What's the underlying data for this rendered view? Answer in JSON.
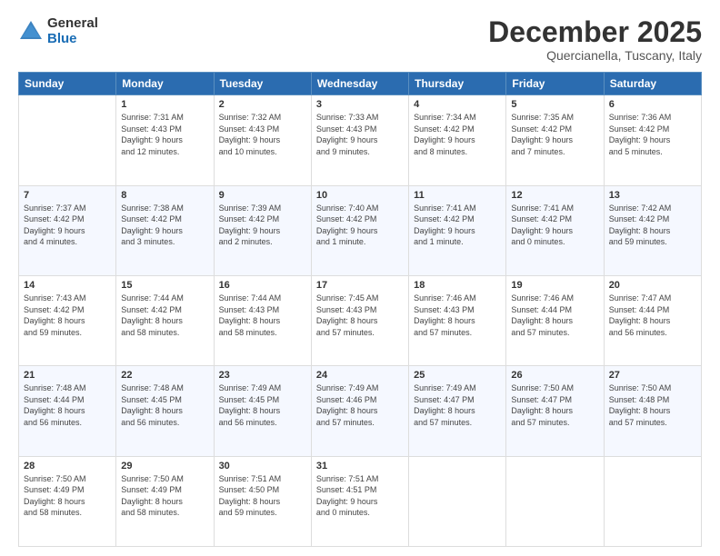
{
  "logo": {
    "general": "General",
    "blue": "Blue"
  },
  "title": {
    "month": "December 2025",
    "location": "Quercianella, Tuscany, Italy"
  },
  "days_header": [
    "Sunday",
    "Monday",
    "Tuesday",
    "Wednesday",
    "Thursday",
    "Friday",
    "Saturday"
  ],
  "weeks": [
    [
      {
        "day": "",
        "info": ""
      },
      {
        "day": "1",
        "info": "Sunrise: 7:31 AM\nSunset: 4:43 PM\nDaylight: 9 hours\nand 12 minutes."
      },
      {
        "day": "2",
        "info": "Sunrise: 7:32 AM\nSunset: 4:43 PM\nDaylight: 9 hours\nand 10 minutes."
      },
      {
        "day": "3",
        "info": "Sunrise: 7:33 AM\nSunset: 4:43 PM\nDaylight: 9 hours\nand 9 minutes."
      },
      {
        "day": "4",
        "info": "Sunrise: 7:34 AM\nSunset: 4:42 PM\nDaylight: 9 hours\nand 8 minutes."
      },
      {
        "day": "5",
        "info": "Sunrise: 7:35 AM\nSunset: 4:42 PM\nDaylight: 9 hours\nand 7 minutes."
      },
      {
        "day": "6",
        "info": "Sunrise: 7:36 AM\nSunset: 4:42 PM\nDaylight: 9 hours\nand 5 minutes."
      }
    ],
    [
      {
        "day": "7",
        "info": "Sunrise: 7:37 AM\nSunset: 4:42 PM\nDaylight: 9 hours\nand 4 minutes."
      },
      {
        "day": "8",
        "info": "Sunrise: 7:38 AM\nSunset: 4:42 PM\nDaylight: 9 hours\nand 3 minutes."
      },
      {
        "day": "9",
        "info": "Sunrise: 7:39 AM\nSunset: 4:42 PM\nDaylight: 9 hours\nand 2 minutes."
      },
      {
        "day": "10",
        "info": "Sunrise: 7:40 AM\nSunset: 4:42 PM\nDaylight: 9 hours\nand 1 minute."
      },
      {
        "day": "11",
        "info": "Sunrise: 7:41 AM\nSunset: 4:42 PM\nDaylight: 9 hours\nand 1 minute."
      },
      {
        "day": "12",
        "info": "Sunrise: 7:41 AM\nSunset: 4:42 PM\nDaylight: 9 hours\nand 0 minutes."
      },
      {
        "day": "13",
        "info": "Sunrise: 7:42 AM\nSunset: 4:42 PM\nDaylight: 8 hours\nand 59 minutes."
      }
    ],
    [
      {
        "day": "14",
        "info": "Sunrise: 7:43 AM\nSunset: 4:42 PM\nDaylight: 8 hours\nand 59 minutes."
      },
      {
        "day": "15",
        "info": "Sunrise: 7:44 AM\nSunset: 4:42 PM\nDaylight: 8 hours\nand 58 minutes."
      },
      {
        "day": "16",
        "info": "Sunrise: 7:44 AM\nSunset: 4:43 PM\nDaylight: 8 hours\nand 58 minutes."
      },
      {
        "day": "17",
        "info": "Sunrise: 7:45 AM\nSunset: 4:43 PM\nDaylight: 8 hours\nand 57 minutes."
      },
      {
        "day": "18",
        "info": "Sunrise: 7:46 AM\nSunset: 4:43 PM\nDaylight: 8 hours\nand 57 minutes."
      },
      {
        "day": "19",
        "info": "Sunrise: 7:46 AM\nSunset: 4:44 PM\nDaylight: 8 hours\nand 57 minutes."
      },
      {
        "day": "20",
        "info": "Sunrise: 7:47 AM\nSunset: 4:44 PM\nDaylight: 8 hours\nand 56 minutes."
      }
    ],
    [
      {
        "day": "21",
        "info": "Sunrise: 7:48 AM\nSunset: 4:44 PM\nDaylight: 8 hours\nand 56 minutes."
      },
      {
        "day": "22",
        "info": "Sunrise: 7:48 AM\nSunset: 4:45 PM\nDaylight: 8 hours\nand 56 minutes."
      },
      {
        "day": "23",
        "info": "Sunrise: 7:49 AM\nSunset: 4:45 PM\nDaylight: 8 hours\nand 56 minutes."
      },
      {
        "day": "24",
        "info": "Sunrise: 7:49 AM\nSunset: 4:46 PM\nDaylight: 8 hours\nand 57 minutes."
      },
      {
        "day": "25",
        "info": "Sunrise: 7:49 AM\nSunset: 4:47 PM\nDaylight: 8 hours\nand 57 minutes."
      },
      {
        "day": "26",
        "info": "Sunrise: 7:50 AM\nSunset: 4:47 PM\nDaylight: 8 hours\nand 57 minutes."
      },
      {
        "day": "27",
        "info": "Sunrise: 7:50 AM\nSunset: 4:48 PM\nDaylight: 8 hours\nand 57 minutes."
      }
    ],
    [
      {
        "day": "28",
        "info": "Sunrise: 7:50 AM\nSunset: 4:49 PM\nDaylight: 8 hours\nand 58 minutes."
      },
      {
        "day": "29",
        "info": "Sunrise: 7:50 AM\nSunset: 4:49 PM\nDaylight: 8 hours\nand 58 minutes."
      },
      {
        "day": "30",
        "info": "Sunrise: 7:51 AM\nSunset: 4:50 PM\nDaylight: 8 hours\nand 59 minutes."
      },
      {
        "day": "31",
        "info": "Sunrise: 7:51 AM\nSunset: 4:51 PM\nDaylight: 9 hours\nand 0 minutes."
      },
      {
        "day": "",
        "info": ""
      },
      {
        "day": "",
        "info": ""
      },
      {
        "day": "",
        "info": ""
      }
    ]
  ]
}
